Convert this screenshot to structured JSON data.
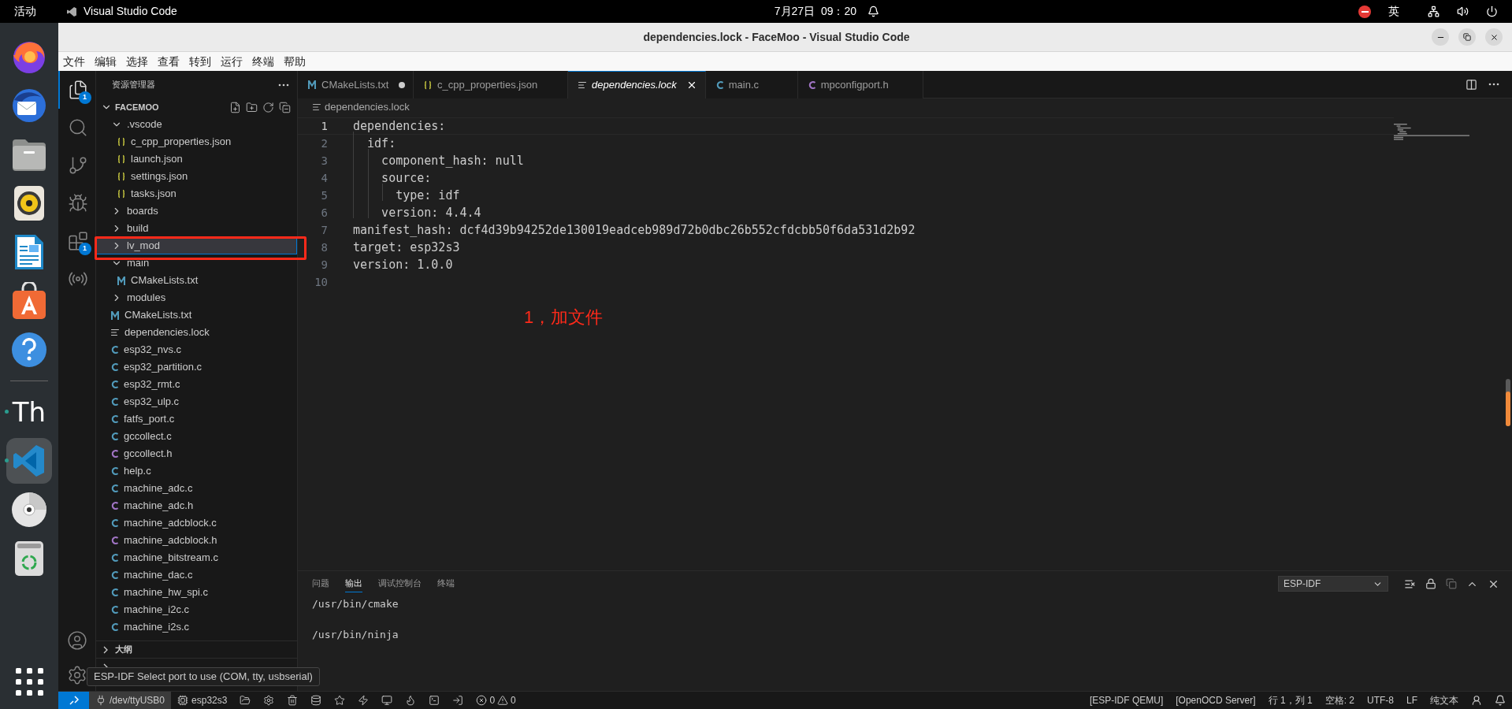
{
  "top_bar": {
    "activities": "活动",
    "app_name": "Visual Studio Code",
    "clock": "7月27日  09：20",
    "input_method": "英"
  },
  "dock": [
    {
      "kind": "firefox",
      "selected": false,
      "running": false
    },
    {
      "kind": "thunderbird",
      "selected": false,
      "running": false
    },
    {
      "kind": "files",
      "selected": false,
      "running": false
    },
    {
      "kind": "rhythmbox",
      "selected": false,
      "running": false
    },
    {
      "kind": "writer",
      "selected": false,
      "running": false
    },
    {
      "kind": "appcenter",
      "selected": false,
      "running": false
    },
    {
      "kind": "help",
      "selected": false,
      "running": false
    },
    {
      "kind": "thonny",
      "label": "Th",
      "selected": false,
      "running": true
    },
    {
      "kind": "vscode",
      "selected": true,
      "running": true
    },
    {
      "kind": "disc",
      "selected": false,
      "running": false
    },
    {
      "kind": "trash",
      "selected": false,
      "running": false
    }
  ],
  "window": {
    "title": "dependencies.lock - FaceMoo - Visual Studio Code"
  },
  "menu": [
    "文件",
    "编辑",
    "选择",
    "查看",
    "转到",
    "运行",
    "终端",
    "帮助"
  ],
  "activity_bar": [
    {
      "kind": "explorer",
      "selected": true,
      "badge": "1"
    },
    {
      "kind": "search",
      "selected": false
    },
    {
      "kind": "source_control",
      "selected": false
    },
    {
      "kind": "run_debug",
      "selected": false
    },
    {
      "kind": "extensions",
      "selected": false,
      "badge": "1"
    },
    {
      "kind": "espressif",
      "selected": false
    }
  ],
  "sidebar": {
    "title": "资源管理器",
    "root": {
      "label": "FACEMOO",
      "expanded": true,
      "children": [
        {
          "kind": "folder",
          "label": ".vscode",
          "expanded": true,
          "selected": false,
          "children": [
            {
              "kind": "json",
              "label": "c_cpp_properties.json",
              "selected": false
            },
            {
              "kind": "json",
              "label": "launch.json",
              "selected": false
            },
            {
              "kind": "json",
              "label": "settings.json",
              "selected": false
            },
            {
              "kind": "json",
              "label": "tasks.json",
              "selected": false
            }
          ]
        },
        {
          "kind": "folder",
          "label": "boards",
          "expanded": false,
          "selected": false
        },
        {
          "kind": "folder",
          "label": "build",
          "expanded": false,
          "selected": false
        },
        {
          "kind": "folder",
          "label": "lv_mod",
          "expanded": false,
          "selected": true
        },
        {
          "kind": "folder",
          "label": "main",
          "expanded": true,
          "selected": false,
          "children": [
            {
              "kind": "cmake",
              "label": "CMakeLists.txt",
              "selected": false
            }
          ]
        },
        {
          "kind": "folder",
          "label": "modules",
          "expanded": false,
          "selected": false
        },
        {
          "kind": "cmake",
          "label": "CMakeLists.txt",
          "selected": false
        },
        {
          "kind": "lock",
          "label": "dependencies.lock",
          "selected": false
        },
        {
          "kind": "c",
          "label": "esp32_nvs.c",
          "selected": false
        },
        {
          "kind": "c",
          "label": "esp32_partition.c",
          "selected": false
        },
        {
          "kind": "c",
          "label": "esp32_rmt.c",
          "selected": false
        },
        {
          "kind": "c",
          "label": "esp32_ulp.c",
          "selected": false
        },
        {
          "kind": "c",
          "label": "fatfs_port.c",
          "selected": false
        },
        {
          "kind": "c",
          "label": "gccollect.c",
          "selected": false
        },
        {
          "kind": "h",
          "label": "gccollect.h",
          "selected": false
        },
        {
          "kind": "c",
          "label": "help.c",
          "selected": false
        },
        {
          "kind": "c",
          "label": "machine_adc.c",
          "selected": false
        },
        {
          "kind": "h",
          "label": "machine_adc.h",
          "selected": false
        },
        {
          "kind": "c",
          "label": "machine_adcblock.c",
          "selected": false
        },
        {
          "kind": "h",
          "label": "machine_adcblock.h",
          "selected": false
        },
        {
          "kind": "c",
          "label": "machine_bitstream.c",
          "selected": false
        },
        {
          "kind": "c",
          "label": "machine_dac.c",
          "selected": false
        },
        {
          "kind": "c",
          "label": "machine_hw_spi.c",
          "selected": false
        },
        {
          "kind": "c",
          "label": "machine_i2c.c",
          "selected": false
        },
        {
          "kind": "c",
          "label": "machine_i2s.c",
          "selected": false
        }
      ]
    },
    "sections": [
      {
        "label": "大纲",
        "expanded": false
      },
      {
        "expanded": false
      }
    ]
  },
  "tabs": [
    {
      "kind": "cmake",
      "label": "CMakeLists.txt",
      "selected": false,
      "modified": true
    },
    {
      "kind": "json",
      "label": "c_cpp_properties.json",
      "selected": false,
      "modified": false
    },
    {
      "kind": "lock",
      "label": "dependencies.lock",
      "selected": true,
      "modified": false
    },
    {
      "kind": "c",
      "label": "main.c",
      "selected": false,
      "modified": false
    },
    {
      "kind": "h",
      "label": "mpconfigport.h",
      "selected": false,
      "modified": false
    }
  ],
  "breadcrumb": "dependencies.lock",
  "code": [
    {
      "number": "1",
      "text": "dependencies:",
      "current": true
    },
    {
      "number": "2",
      "text": "  idf:",
      "current": false
    },
    {
      "number": "3",
      "text": "    component_hash: null",
      "current": false
    },
    {
      "number": "4",
      "text": "    source:",
      "current": false
    },
    {
      "number": "5",
      "text": "      type: idf",
      "current": false
    },
    {
      "number": "6",
      "text": "    version: 4.4.4",
      "current": false
    },
    {
      "number": "7",
      "text": "manifest_hash: dcf4d39b94252de130019eadceb989d72b0dbc26b552cfdcbb50f6da531d2b92",
      "current": false
    },
    {
      "number": "8",
      "text": "target: esp32s3",
      "current": false
    },
    {
      "number": "9",
      "text": "version: 1.0.0",
      "current": false
    },
    {
      "number": "10",
      "current": false
    }
  ],
  "annotation": {
    "text": "1，加文件",
    "color": "#ff2a1a"
  },
  "panel": {
    "tabs": [
      {
        "label": "问题",
        "selected": false
      },
      {
        "label": "输出",
        "selected": true
      },
      {
        "label": "调试控制台",
        "selected": false
      },
      {
        "label": "终端",
        "selected": false
      }
    ],
    "channel": "ESP-IDF",
    "output": [
      "/usr/bin/cmake",
      "/usr/bin/ninja"
    ]
  },
  "tooltip": "ESP-IDF Select port to use (COM, tty, usbserial)",
  "status_bar": {
    "left": [
      {
        "kind": "remote"
      },
      {
        "kind": "port",
        "label": "/dev/ttyUSB0"
      },
      {
        "kind": "target",
        "label": "esp32s3"
      },
      {
        "kind": "folder"
      },
      {
        "kind": "settings"
      },
      {
        "kind": "trash"
      },
      {
        "kind": "database"
      },
      {
        "kind": "star"
      },
      {
        "kind": "flash"
      },
      {
        "kind": "monitor"
      },
      {
        "kind": "flame"
      },
      {
        "kind": "terminal"
      },
      {
        "kind": "enter"
      },
      {
        "kind": "problems",
        "errors": "0",
        "warnings": "0"
      }
    ],
    "right": [
      "[ESP-IDF QEMU]",
      "[OpenOCD Server]",
      "行 1，列 1",
      "空格: 2",
      "UTF-8",
      "LF",
      "纯文本"
    ]
  }
}
